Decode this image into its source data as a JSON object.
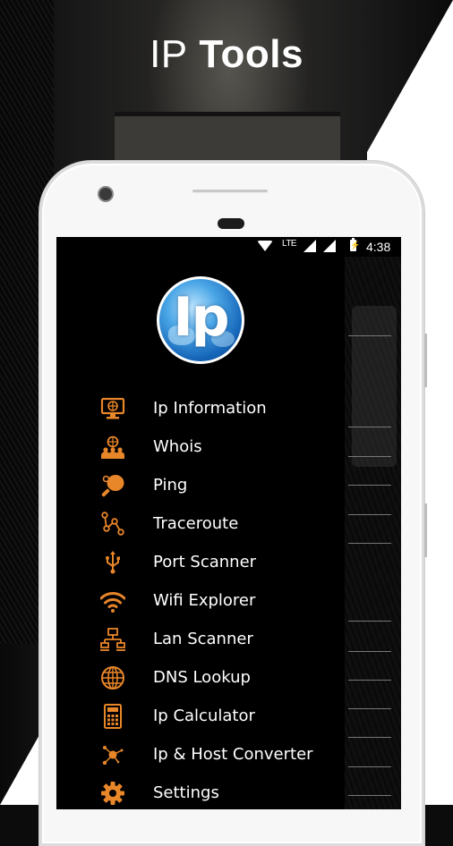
{
  "headline": {
    "light": "IP",
    "bold": "Tools"
  },
  "status_bar": {
    "network": "LTE",
    "time": "4:38"
  },
  "app": {
    "logo_text": "Ip"
  },
  "accent_color": "#e8862a",
  "menu": [
    {
      "label": "Ip Information",
      "icon": "monitor-globe-icon"
    },
    {
      "label": "Whois",
      "icon": "people-globe-icon"
    },
    {
      "label": "Ping",
      "icon": "ping-pong-icon"
    },
    {
      "label": "Traceroute",
      "icon": "route-nodes-icon"
    },
    {
      "label": "Port Scanner",
      "icon": "usb-icon"
    },
    {
      "label": "Wifi Explorer",
      "icon": "wifi-icon"
    },
    {
      "label": "Lan Scanner",
      "icon": "lan-network-icon"
    },
    {
      "label": "DNS Lookup",
      "icon": "globe-icon"
    },
    {
      "label": "Ip Calculator",
      "icon": "calculator-icon"
    },
    {
      "label": "Ip & Host Converter",
      "icon": "hub-nodes-icon"
    },
    {
      "label": "Settings",
      "icon": "gear-icon"
    }
  ]
}
